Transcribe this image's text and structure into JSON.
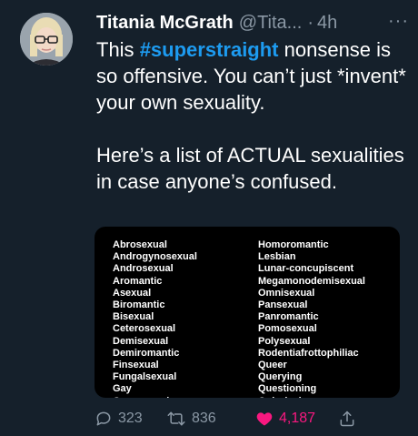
{
  "tweet": {
    "author_name": "Titania McGrath",
    "handle": "@Tita...",
    "separator": "·",
    "time": "4h",
    "more": "···",
    "text_before_hashtag": "This ",
    "hashtag": "#superstraight",
    "text_after_hashtag": " nonsense is so offensive. You can’t just *invent* your own sexuality.",
    "paragraph2": "Here’s a list of ACTUAL sexualities in case anyone’s confused."
  },
  "media": {
    "left_column": [
      "Abrosexual",
      "Androgynosexual",
      "Androsexual",
      "Aromantic",
      "Asexual",
      "Biromantic",
      "Bisexual",
      "Ceterosexual",
      "Demisexual",
      "Demiromantic",
      "Finsexual",
      "Fungalsexual",
      "Gay",
      "Gynosexual"
    ],
    "right_column": [
      "Homoromantic",
      "Lesbian",
      "Lunar-concupiscent",
      "Megamonodemisexual",
      "Omnisexual",
      "Pansexual",
      "Panromantic",
      "Pomosexual",
      "Polysexual",
      "Rodentiafrottophiliac",
      "Queer",
      "Querying",
      "Questioning",
      "Quizzical"
    ]
  },
  "actions": {
    "reply_icon": "reply-icon",
    "reply_count": "323",
    "retweet_icon": "retweet-icon",
    "retweet_count": "836",
    "like_icon": "heart-icon",
    "like_count": "4,187",
    "share_icon": "share-icon"
  },
  "colors": {
    "background": "#15202b",
    "accent": "#1d9bf0",
    "muted": "#8b98a5",
    "like": "#f91880"
  }
}
